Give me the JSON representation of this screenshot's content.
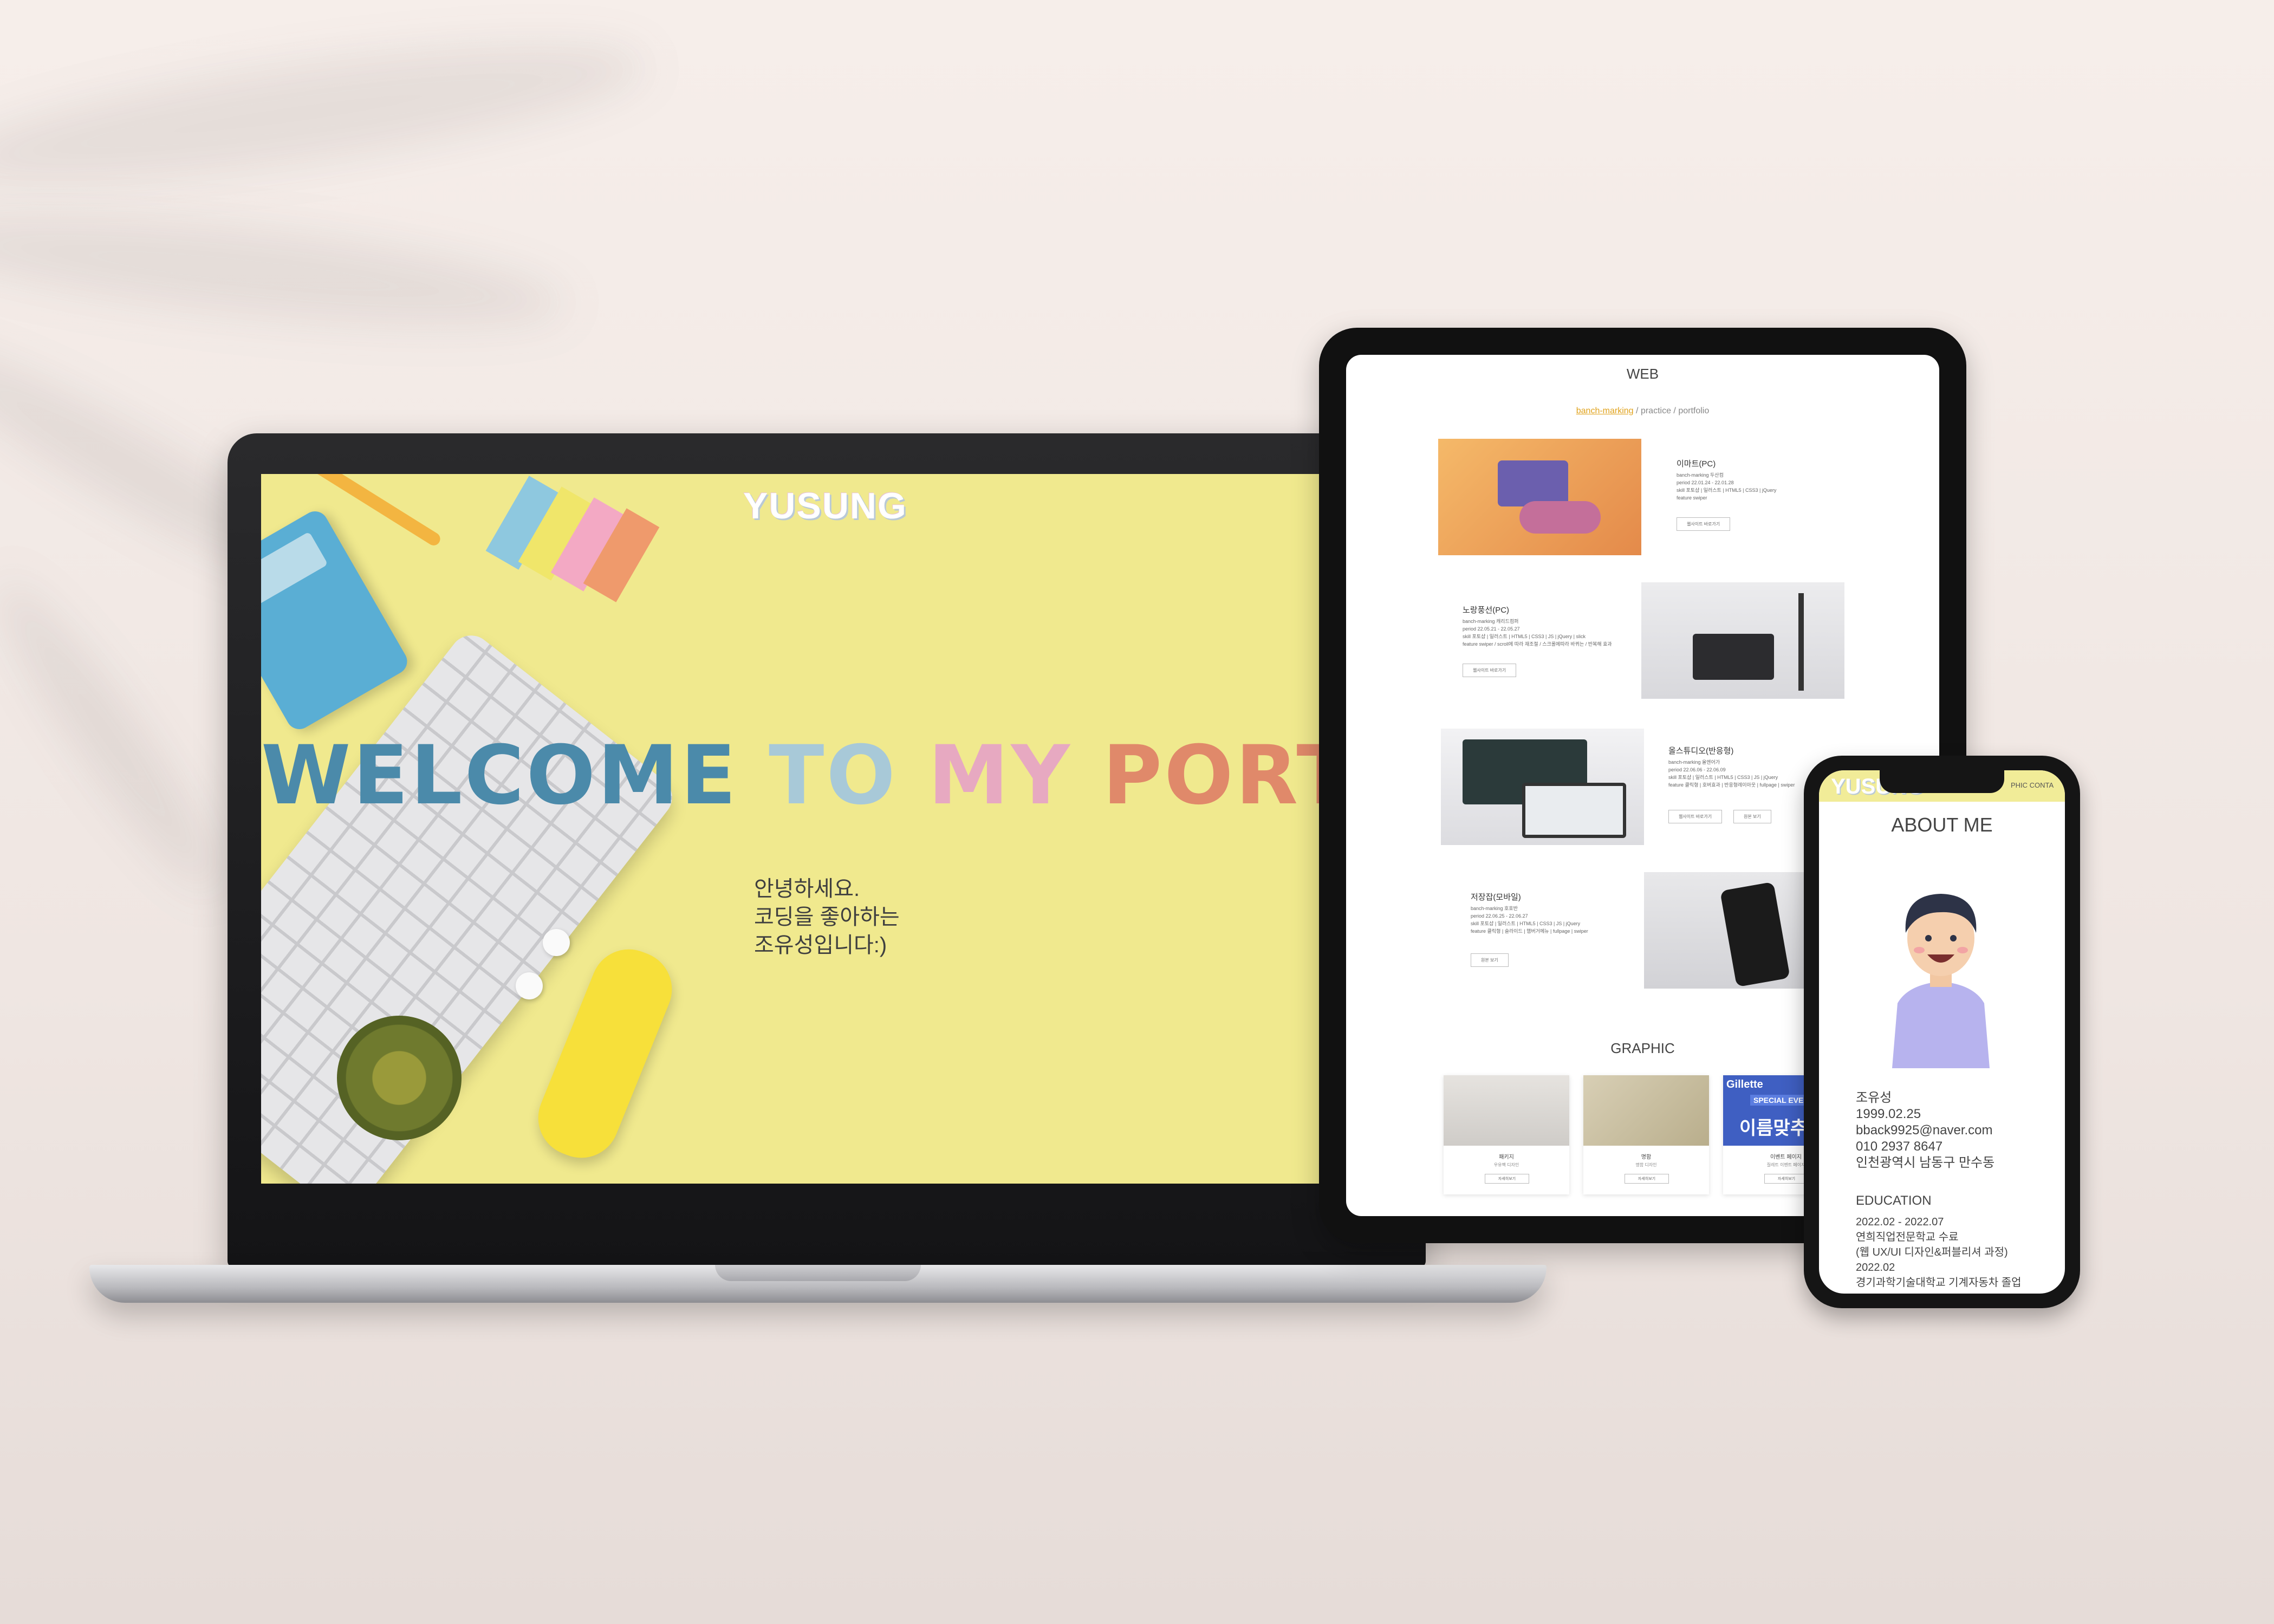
{
  "laptop": {
    "logo": "YUSUNG",
    "welcome": {
      "part1": "WELCOME",
      "part2": "TO",
      "part3": "MY",
      "part4": "PORTFOLIO"
    },
    "intro": [
      "안녕하세요.",
      "코딩을 좋아하는",
      "조유성입니다:)"
    ],
    "colors": {
      "screen_bg": "#f0e98e",
      "welcome": "#4b8aaa",
      "to": "#a8c9d8",
      "my": "#e7a9c1",
      "portfolio": "#e0896a"
    }
  },
  "tablet": {
    "web_heading": "WEB",
    "nav": {
      "item1": "banch-marking",
      "sep": "/",
      "item2": "practice",
      "item3": "portfolio"
    },
    "projects": [
      {
        "title": "이마트(PC)",
        "meta": [
          "banch-marking   두산컴",
          "period      22.01.24 - 22.01.28",
          "skill       포토샵 | 일러스트 | HTML5 | CSS3 | jQuery",
          "feature     swiper"
        ],
        "buttons": [
          "웹사이트 바로가기"
        ]
      },
      {
        "title": "노랑풍선(PC)",
        "meta": [
          "banch-marking   캐리드컴퍼",
          "period      22.05.21 - 22.05.27",
          "skill       포토샵 | 일러스트 | HTML5 | CSS3 | JS | jQuery | slick",
          "feature     swiper / scroll에 따라 재조절 / 스크롤에따라 바뀌는 / 반복해 효과"
        ],
        "buttons": [
          "웹사이트 바로가기"
        ]
      },
      {
        "title": "올스튜디오(반응형)",
        "meta": [
          "banch-marking   올엔어가",
          "period      22.06.06 - 22.06.09",
          "skill       포토샵 | 일러스트 | HTML5 | CSS3 | JS | jQuery",
          "feature     클릭형 | 호버효과 | 반응형레이아웃 | fullpage | swiper"
        ],
        "buttons": [
          "웹사이트 바로가기",
          "원본 보기"
        ]
      },
      {
        "title": "저장잡(모바일)",
        "meta": [
          "banch-marking   호호반",
          "period      22.06.25 - 22.06.27",
          "skill       포토샵 | 일러스트 | HTML5 | CSS3 | JS | jQuery",
          "feature     클릭형 | 슬라이드 | 햄버거메뉴 | fullpage | swiper"
        ],
        "buttons": [
          "원본 보기"
        ]
      }
    ],
    "graphic_heading": "GRAPHIC",
    "graphics": [
      {
        "title": "패키지",
        "sub": "우유팩 디자인",
        "button": "자세히보기"
      },
      {
        "title": "명함",
        "sub": "명함 디자인",
        "button": "자세히보기"
      },
      {
        "banner": "Gillette",
        "event": "SPECIAL EVENT",
        "headline": "이름맞추",
        "title": "이벤트 페이지",
        "sub": "질레트 이벤트 페이지",
        "button": "자세히보기"
      }
    ]
  },
  "phone": {
    "logo": "YUSUNG",
    "menu": "PHIC  CONTA",
    "about_title": "ABOUT ME",
    "profile": [
      "조유성",
      "1999.02.25",
      "bback9925@naver.com",
      "010 2937 8647",
      "인천광역시 남동구 만수동"
    ],
    "education_heading": "EDUCATION",
    "education": [
      {
        "period": "2022.02 - 2022.07",
        "lines": [
          "연희직업전문학교 수료",
          "(웹 UX/UI 디자인&퍼블리셔 과정)"
        ]
      },
      {
        "period": "2022.02",
        "lines": [
          "경기과학기술대학교 기계자동차 졸업"
        ]
      }
    ]
  }
}
